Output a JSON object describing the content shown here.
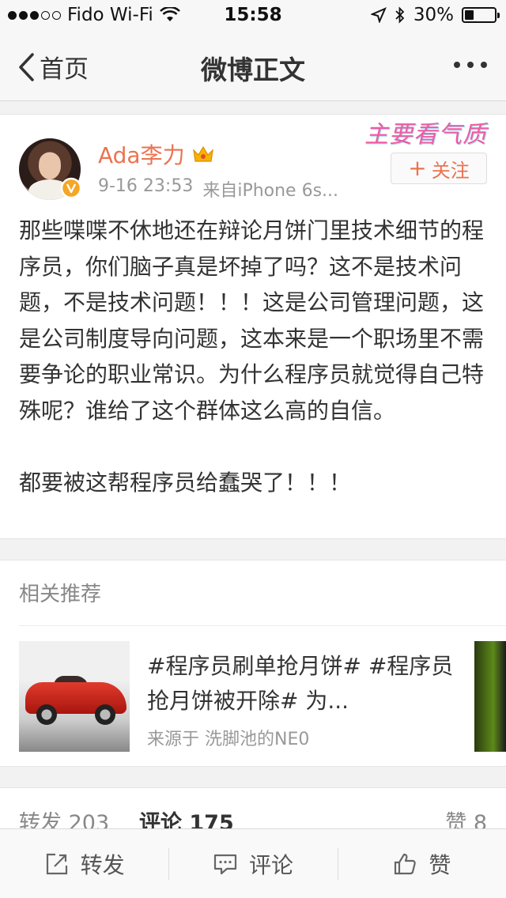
{
  "status_bar": {
    "carrier": "Fido Wi-Fi",
    "time": "15:58",
    "battery_text": "30%",
    "battery_level": 0.3
  },
  "nav": {
    "back_label": "首页",
    "title": "微博正文"
  },
  "post": {
    "author": "Ada李力",
    "time": "9-16 23:53",
    "source": "来自iPhone 6s...",
    "follow_label": "关注",
    "badge_text": "主要看气质",
    "text": "那些喋喋不休地还在辩论月饼门里技术细节的程序员，你们脑子真是坏掉了吗？这不是技术问题，不是技术问题！！！这是公司管理问题，这是公司制度导向问题，这本来是一个职场里不需要争论的职业常识。为什么程序员就觉得自己特殊呢？谁给了这个群体这么高的自信。\n\n都要被这帮程序员给蠢哭了！！！"
  },
  "related": {
    "section_title": "相关推荐",
    "items": [
      {
        "title": "#程序员刷单抢月饼# #程序员抢月饼被开除# 为...",
        "source": "来源于 洗脚池的NE0"
      }
    ]
  },
  "counts": {
    "repost": "转发 203",
    "comment": "评论 175",
    "like": "赞 8"
  },
  "toolbar": {
    "repost_label": "转发",
    "comment_label": "评论",
    "like_label": "赞"
  },
  "colors": {
    "accent": "#eb7350",
    "verified": "#f5a623"
  },
  "icons": [
    "wifi-icon",
    "location-arrow-icon",
    "bluetooth-icon",
    "battery-icon",
    "back-chevron-icon",
    "more-icon",
    "crown-icon",
    "verified-icon",
    "repost-icon",
    "comment-icon",
    "like-icon"
  ]
}
